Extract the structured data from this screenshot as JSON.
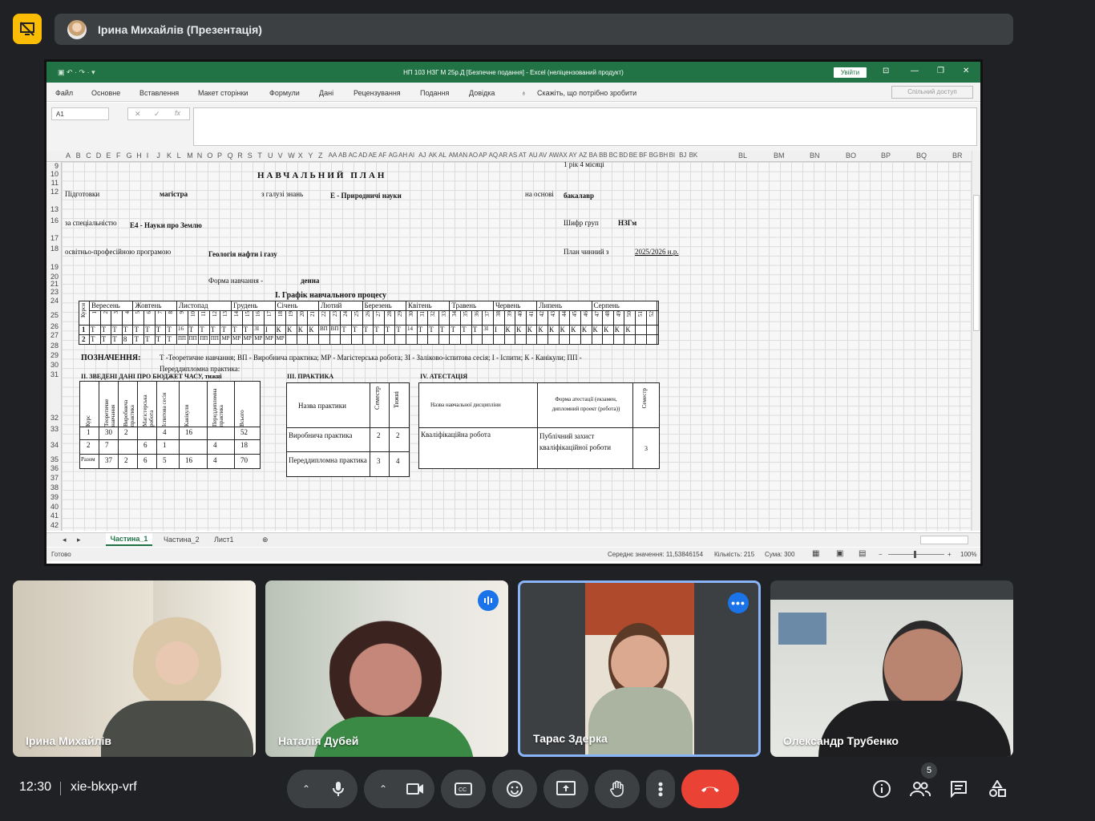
{
  "presenter": {
    "name": "Ірина Михайлів (Презентація)"
  },
  "excel": {
    "window_title": "НП 103 НЗГ М 25р.Д  [Безпечне подання]  -  Excel (неліцензований продукт)",
    "login_button": "Увійти",
    "ribbon_tabs": [
      "Файл",
      "Основне",
      "Вставлення",
      "Макет сторінки",
      "Формули",
      "Дані",
      "Рецензування",
      "Подання",
      "Довідка"
    ],
    "tell_me": "Скажіть, що потрібно зробити",
    "share_button": "Спільний доступ",
    "name_box": "A1",
    "fx_label": "fx",
    "columns": [
      "A",
      "B",
      "C",
      "D",
      "E",
      "F",
      "G",
      "H",
      "I",
      "J",
      "K",
      "L",
      "M",
      "N",
      "O",
      "P",
      "Q",
      "R",
      "S",
      "T",
      "U",
      "V",
      "W",
      "X",
      "Y",
      "Z",
      "AA",
      "AB",
      "AC",
      "AD",
      "AE",
      "AF",
      "AG",
      "AH",
      "AI",
      "AJ",
      "AK",
      "AL",
      "AM",
      "AN",
      "AO",
      "AP",
      "AQ",
      "AR",
      "AS",
      "AT",
      "AU",
      "AV",
      "AW",
      "AX",
      "AY",
      "AZ",
      "BA",
      "BB",
      "BC",
      "BD",
      "BE",
      "BF",
      "BG",
      "BH",
      "BI",
      "BJ",
      "BK",
      "BL",
      "BM",
      "BN",
      "BO",
      "BP",
      "BQ",
      "BR"
    ],
    "rows": [
      "9",
      "10",
      "11",
      "12",
      "13",
      "16",
      "17",
      "18",
      "19",
      "20",
      "21",
      "23",
      "24",
      "25",
      "26",
      "27",
      "28",
      "29",
      "30",
      "31",
      "32",
      "33",
      "34",
      "35",
      "36",
      "37",
      "38",
      "39",
      "40",
      "41",
      "42"
    ],
    "sheet": {
      "cut_top_text": "1 рік 4 місяці",
      "title": "НАВЧАЛЬНИЙ ПЛАН",
      "prep_label": "Підготовки",
      "prep_value": "магістра",
      "field_label": "з галузі знань",
      "field_value": "E - Природничі науки",
      "basis_label": "на основі",
      "basis_value": "бакалавр",
      "spec_label": "за спеціальністю",
      "spec_value": "E4 - Науки про Землю",
      "group_label": "Шифр груп",
      "group_value": "НЗГм",
      "program_label": "освітньо-професійною програмою",
      "program_value": "Геологія нафти і газу",
      "plan_label": "План чинний з",
      "plan_value": "2025/2026 н.р.",
      "form_label": "Форма навчання -",
      "form_value": "денна",
      "schedule_title": "І. Графік навчального процесу",
      "months_header": "Курси",
      "months": [
        "Вересень",
        "Жовтень",
        "Листопад",
        "Грудень",
        "Січень",
        "Лютий",
        "Березень",
        "Квітень",
        "Травень",
        "Червень",
        "Липень",
        "Серпень"
      ],
      "week_numbers": [
        "1",
        "2",
        "3",
        "4",
        "5",
        "6",
        "7",
        "8",
        "9",
        "10",
        "11",
        "12",
        "13",
        "14",
        "15",
        "16",
        "17",
        "18",
        "19",
        "20",
        "21",
        "22",
        "23",
        "24",
        "25",
        "26",
        "27",
        "28",
        "29",
        "30",
        "31",
        "32",
        "33",
        "34",
        "35",
        "36",
        "37",
        "38",
        "39",
        "40",
        "41",
        "42",
        "43",
        "44",
        "45",
        "46",
        "47",
        "48",
        "49",
        "50",
        "51",
        "52"
      ],
      "course1": [
        "1",
        "Т",
        "Т",
        "Т",
        "Т",
        "Т",
        "Т",
        "Т",
        "Т",
        "16",
        "Т",
        "Т",
        "Т",
        "Т",
        "Т",
        "Т",
        "ЗІ",
        "І",
        "К",
        "К",
        "К",
        "К",
        "ВП",
        "ВП",
        "Т",
        "Т",
        "Т",
        "Т",
        "Т",
        "Т",
        "14",
        "Т",
        "Т",
        "Т",
        "Т",
        "Т",
        "Т",
        "ЗІ",
        "І",
        "К",
        "К",
        "К",
        "К",
        "К",
        "К",
        "К",
        "К",
        "К",
        "К",
        "К",
        "К"
      ],
      "course2": [
        "2",
        "Т",
        "Т",
        "Т",
        "8",
        "Т",
        "Т",
        "Т",
        "Т",
        "ПП",
        "ПП",
        "ПП",
        "ПП",
        "МР",
        "МР",
        "МР",
        "МР",
        "МР",
        "МР"
      ],
      "legend_title": "ПОЗНАЧЕННЯ:",
      "legend_text": "Т -Теоретичне навчання; ВП - Виробнича практика; МР - Магістерська робота; ЗІ - Заліково-іспитова сесія; І - Іспити; К - Канікули; ПП -",
      "legend_text2": "Переддипломна практика:",
      "budget_title": "ІІ. ЗВЕДЕНІ ДАНІ ПРО БЮДЖЕТ ЧАСУ, тижні",
      "budget_headers": [
        "Курс",
        "Теоретичне навчання",
        "Виробнича практика",
        "Магістерська робота",
        "Іспитова сесія",
        "Канікули",
        "Переддипломна практика",
        "Всього"
      ],
      "budget_rows": [
        [
          "1",
          "30",
          "2",
          "",
          "4",
          "16",
          "",
          "52"
        ],
        [
          "2",
          "7",
          "",
          "6",
          "1",
          "",
          "4",
          "18"
        ],
        [
          "Разом",
          "37",
          "2",
          "6",
          "5",
          "16",
          "4",
          "70"
        ]
      ],
      "practice_title": "ІІІ. ПРАКТИКА",
      "practice_headers": [
        "Назва практики",
        "Семестр",
        "Тижні"
      ],
      "practice_rows": [
        [
          "Виробнича практика",
          "2",
          "2"
        ],
        [
          "Переддипломна практика",
          "3",
          "4"
        ]
      ],
      "attest_title": "IV. АТЕСТАЦІЯ",
      "attest_headers": [
        "Назва навчальної дисципліни",
        "Форма атестації (екзамен, дипломний проект (робота))",
        "Семестр"
      ],
      "attest_row": [
        "Кваліфікаційна робота",
        "Публічний захист кваліфікаційної роботи",
        "3"
      ]
    },
    "sheets": [
      "Частина_1",
      "Частина_2",
      "Лист1"
    ],
    "status": {
      "ready": "Готово",
      "average": "Середнє значення: 11,53846154",
      "count": "Кількість: 215",
      "sum": "Сума: 300",
      "zoom": "100%"
    }
  },
  "participants": [
    {
      "name": "Ірина Михайлів"
    },
    {
      "name": "Наталія Дубей"
    },
    {
      "name": "Тарас Здерка"
    },
    {
      "name": "Олександр Трубенко"
    }
  ],
  "bottom_bar": {
    "time": "12:30",
    "meeting_code": "xie-bkxp-vrf",
    "people_count": "5"
  },
  "colors": {
    "excel_green": "#217346",
    "meet_bg": "#202124",
    "end_call": "#ea4335",
    "present_badge": "#fbbc04",
    "active_blue": "#1a73e8"
  }
}
